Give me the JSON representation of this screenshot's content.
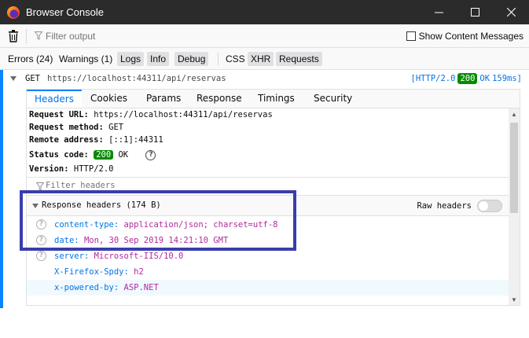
{
  "window": {
    "title": "Browser Console"
  },
  "toolbar": {
    "filter_placeholder": "Filter output",
    "show_content_label": "Show Content Messages"
  },
  "filters": {
    "errors": "Errors (24)",
    "warnings": "Warnings (1)",
    "logs": "Logs",
    "info": "Info",
    "debug": "Debug",
    "css": "CSS",
    "xhr": "XHR",
    "requests": "Requests"
  },
  "request": {
    "method": "GET",
    "url": "https://localhost:44311/api/reservas",
    "protocol": "[HTTP/2.0",
    "status": "200",
    "status_text": "OK",
    "time": "159ms]"
  },
  "tabs": [
    "Headers",
    "Cookies",
    "Params",
    "Response",
    "Timings",
    "Security"
  ],
  "summary": {
    "url_label": "Request URL:",
    "url_value": "https://localhost:44311/api/reservas",
    "method_label": "Request method:",
    "method_value": "GET",
    "remote_label": "Remote address:",
    "remote_value": "[::1]:44311",
    "status_label": "Status code:",
    "status_code": "200",
    "status_text": "OK",
    "version_label": "Version:",
    "version_value": "HTTP/2.0"
  },
  "filter_headers_placeholder": "Filter headers",
  "response_headers": {
    "title": "Response headers (174 B)",
    "raw_label": "Raw headers",
    "items": [
      {
        "name": "content-type:",
        "value": "application/json; charset=utf-8"
      },
      {
        "name": "date:",
        "value": "Mon, 30 Sep 2019 14:21:10 GMT"
      },
      {
        "name": "server:",
        "value": "Microsoft-IIS/10.0"
      },
      {
        "name": "X-Firefox-Spdy:",
        "value": "h2"
      },
      {
        "name": "x-powered-by:",
        "value": "ASP.NET"
      }
    ]
  },
  "colors": {
    "accent": "#0a84ff",
    "status_ok": "#058b00",
    "annotation": "#3a3dac",
    "header_value": "#b02a9f"
  }
}
